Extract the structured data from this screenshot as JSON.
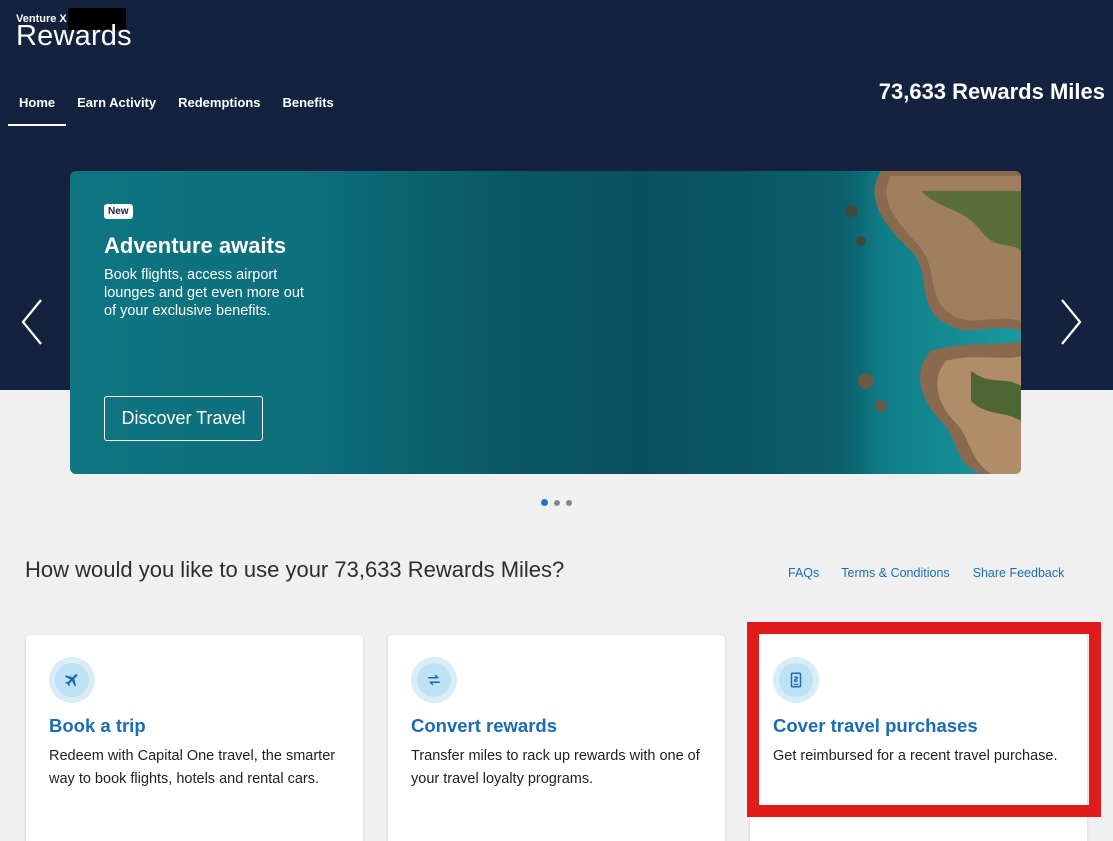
{
  "header": {
    "card_name": "Venture X",
    "title": "Rewards",
    "miles_balance": "73,633 Rewards Miles",
    "tabs": [
      {
        "label": "Home",
        "active": true
      },
      {
        "label": "Earn Activity",
        "active": false
      },
      {
        "label": "Redemptions",
        "active": false
      },
      {
        "label": "Benefits",
        "active": false
      }
    ]
  },
  "carousel": {
    "badge": "New",
    "title": "Adventure awaits",
    "text": "Book flights, access airport lounges and get even more out of your exclusive benefits.",
    "button_label": "Discover Travel",
    "slide_count": 3,
    "active_slide": 1,
    "icons": {
      "prev": "chevron-left-icon",
      "next": "chevron-right-icon"
    }
  },
  "section": {
    "question": "How would you like to use your 73,633 Rewards Miles?",
    "links": {
      "faqs": "FAQs",
      "terms": "Terms & Conditions",
      "feedback": "Share Feedback"
    }
  },
  "cards": [
    {
      "icon": "airplane-icon",
      "title": "Book a trip",
      "description": "Redeem with Capital One travel, the smarter way to book flights, hotels and rental cars."
    },
    {
      "icon": "swap-arrows-icon",
      "title": "Convert rewards",
      "description": "Transfer miles to rack up rewards with one of your travel loyalty programs."
    },
    {
      "icon": "receipt-icon",
      "title": "Cover travel purchases",
      "description": "Get reimbursed for a recent travel purchase."
    }
  ],
  "colors": {
    "header_bg": "#13233f",
    "accent": "#1b6cb3",
    "highlight": "#e01b1b"
  }
}
